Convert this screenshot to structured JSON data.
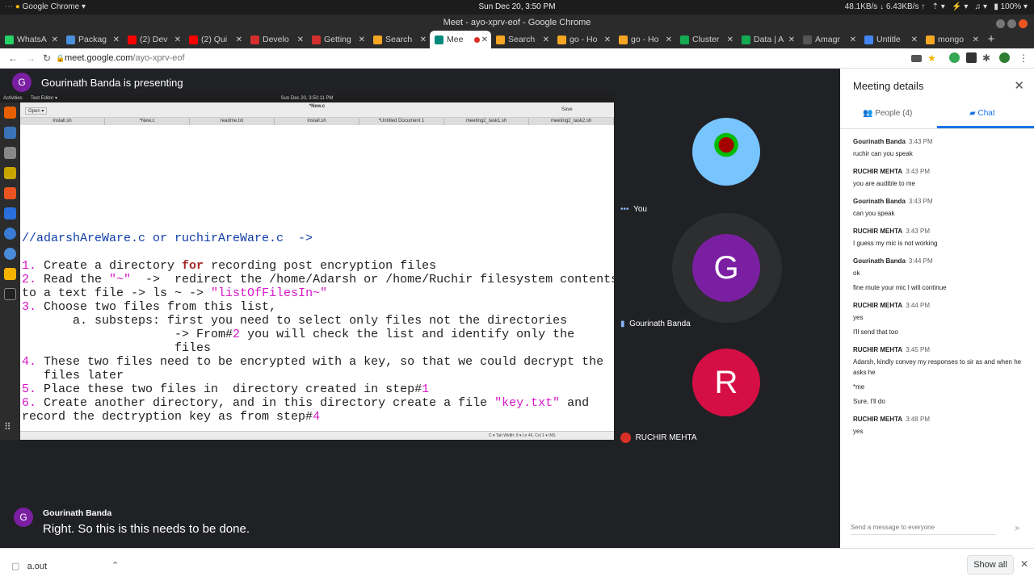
{
  "system": {
    "app_menu": "Google Chrome",
    "datetime": "Sun Dec 20,  3:50 PM",
    "net_down": "48.1KB/s",
    "net_up": "6.43KB/s",
    "battery": "100%"
  },
  "window": {
    "title": "Meet - ayo-xprv-eof - Google Chrome"
  },
  "tabs": [
    {
      "label": "WhatsA",
      "color": "#25d366"
    },
    {
      "label": "Packag",
      "color": "#4a90d9"
    },
    {
      "label": "(2) Dev",
      "color": "#ff0000"
    },
    {
      "label": "(2) Qui",
      "color": "#ff0000"
    },
    {
      "label": "Develo",
      "color": "#d32f2f"
    },
    {
      "label": "Getting",
      "color": "#d32f2f"
    },
    {
      "label": "Search",
      "color": "#f5a623"
    },
    {
      "label": "Mee",
      "color": "#00897b",
      "active": true
    },
    {
      "label": "Search",
      "color": "#f5a623"
    },
    {
      "label": "go - Ho",
      "color": "#f5a623"
    },
    {
      "label": "go - Ho",
      "color": "#f5a623"
    },
    {
      "label": "Cluster",
      "color": "#13aa52"
    },
    {
      "label": "Data | A",
      "color": "#13aa52"
    },
    {
      "label": "Amagr",
      "color": "#555555"
    },
    {
      "label": "Untitle",
      "color": "#4285f4"
    },
    {
      "label": "mongo",
      "color": "#f5a623"
    }
  ],
  "address": {
    "host": "meet.google.com",
    "path": "/ayo-xprv-eof"
  },
  "presenting": {
    "avatar_letter": "G",
    "text": "Gourinath Banda is presenting"
  },
  "shared_screen": {
    "activities": "Activities",
    "app": "Text Editor ▾",
    "clock": "Sun Dec 20,  3:50:11 PM",
    "doc_title": "*New.c",
    "open_label": "Open ▾",
    "save_label": "Save",
    "editor_tabs": [
      "install.sh",
      "*New.c",
      "readme.txt",
      "install.sh",
      "*Untitled Document 1",
      "meeting2_task1.sh",
      "meeting2_task2.sh"
    ],
    "status": "C ▾   Tab Width: 8 ▾      Ln 46, Col 1 ▾        INS"
  },
  "participants": [
    {
      "name": "You",
      "type": "photo"
    },
    {
      "name": "Gourinath Banda",
      "letter": "G",
      "color": "#7b1fa2"
    },
    {
      "name": "RUCHIR MEHTA",
      "letter": "R",
      "color": "#d50f45",
      "muted": true
    }
  ],
  "captions": {
    "speaker": "Gourinath Banda",
    "letter": "G",
    "text": "Right. So this is this needs to be done."
  },
  "panel": {
    "title": "Meeting details",
    "people_tab": "People (4)",
    "chat_tab": "Chat",
    "messages": [
      {
        "sender": "Gourinath Banda",
        "time": "3:43 PM",
        "lines": [
          "ruchir can you speak"
        ]
      },
      {
        "sender": "RUCHIR MEHTA",
        "time": "3:43 PM",
        "lines": [
          "you are audible to me"
        ]
      },
      {
        "sender": "Gourinath Banda",
        "time": "3:43 PM",
        "lines": [
          "can you speak"
        ]
      },
      {
        "sender": "RUCHIR MEHTA",
        "time": "3:43 PM",
        "lines": [
          "I guess my mic is not working"
        ]
      },
      {
        "sender": "Gourinath Banda",
        "time": "3:44 PM",
        "lines": [
          "ok",
          "fine mute your mic I will continue"
        ]
      },
      {
        "sender": "RUCHIR MEHTA",
        "time": "3:44 PM",
        "lines": [
          "yes",
          "I'll send that too"
        ]
      },
      {
        "sender": "RUCHIR MEHTA",
        "time": "3:45 PM",
        "lines": [
          "Adarsh, kindly convey my responses to sir as and when he asks he",
          "*me",
          "Sure, I'll do"
        ]
      },
      {
        "sender": "RUCHIR MEHTA",
        "time": "3:48 PM",
        "lines": [
          "yes"
        ]
      }
    ],
    "send_placeholder": "Send a message to everyone"
  },
  "downloads": {
    "file": "a.out",
    "show_all": "Show all"
  }
}
